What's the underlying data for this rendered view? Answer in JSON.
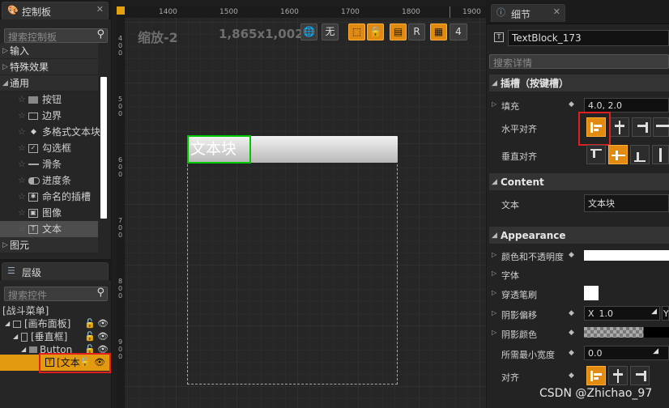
{
  "palette": {
    "title": "控制板",
    "search_placeholder": "搜索控制板",
    "categories": [
      "输入",
      "特殊效果",
      "通用",
      "图元"
    ],
    "items": [
      "按钮",
      "边界",
      "多格式文本块",
      "勾选框",
      "滑条",
      "进度条",
      "命名的插槽",
      "图像",
      "文本"
    ],
    "icons": [
      "button-icon",
      "border-icon",
      "diamond-icon",
      "checkbox-icon",
      "slider-icon",
      "progress-icon",
      "slot-icon",
      "image-icon",
      "text-icon"
    ]
  },
  "hierarchy": {
    "title": "层级",
    "search_placeholder": "搜索控件",
    "root": "[战斗菜单]",
    "nodes": [
      "[画布面板]",
      "[垂直框]",
      "Button",
      "[文本"
    ]
  },
  "designer": {
    "zoom": "缩放-2",
    "resolution": "1,865x1,002",
    "ruler_x": [
      "1400",
      "1500",
      "1600",
      "1700",
      "1800",
      "1900"
    ],
    "ruler_y": [
      "4\n0\n0",
      "5\n0\n0",
      "6\n0\n0",
      "7\n0\n0",
      "8\n0\n0",
      "9\n0\n0"
    ],
    "toolbar": {
      "none_label": "无",
      "r_label": "R",
      "snap_value": "4"
    },
    "text_block": "文本块"
  },
  "details": {
    "title": "细节",
    "widget_name": "TextBlock_173",
    "search_placeholder": "搜索详情",
    "slot_section": "插槽（按键槽）",
    "padding_label": "填充",
    "padding_value": "4.0, 2.0",
    "h_align_label": "水平对齐",
    "v_align_label": "垂直对齐",
    "content_section": "Content",
    "text_label": "文本",
    "text_value": "文本块",
    "appearance_section": "Appearance",
    "color_label": "颜色和不透明度",
    "font_label": "字体",
    "brush_label": "穿透笔刷",
    "shadow_offset_label": "阴影偏移",
    "shadow_x_label": "X",
    "shadow_x_value": "1.0",
    "shadow_y_label": "Y",
    "shadow_color_label": "阴影颜色",
    "min_width_label": "所需最小宽度",
    "min_width_value": "0.0",
    "justify_label": "对齐"
  },
  "watermark": "CSDN @Zhichao_97",
  "colors": {
    "accent": "#e38b10",
    "highlight": "#e02020",
    "selection": "#00c800"
  }
}
